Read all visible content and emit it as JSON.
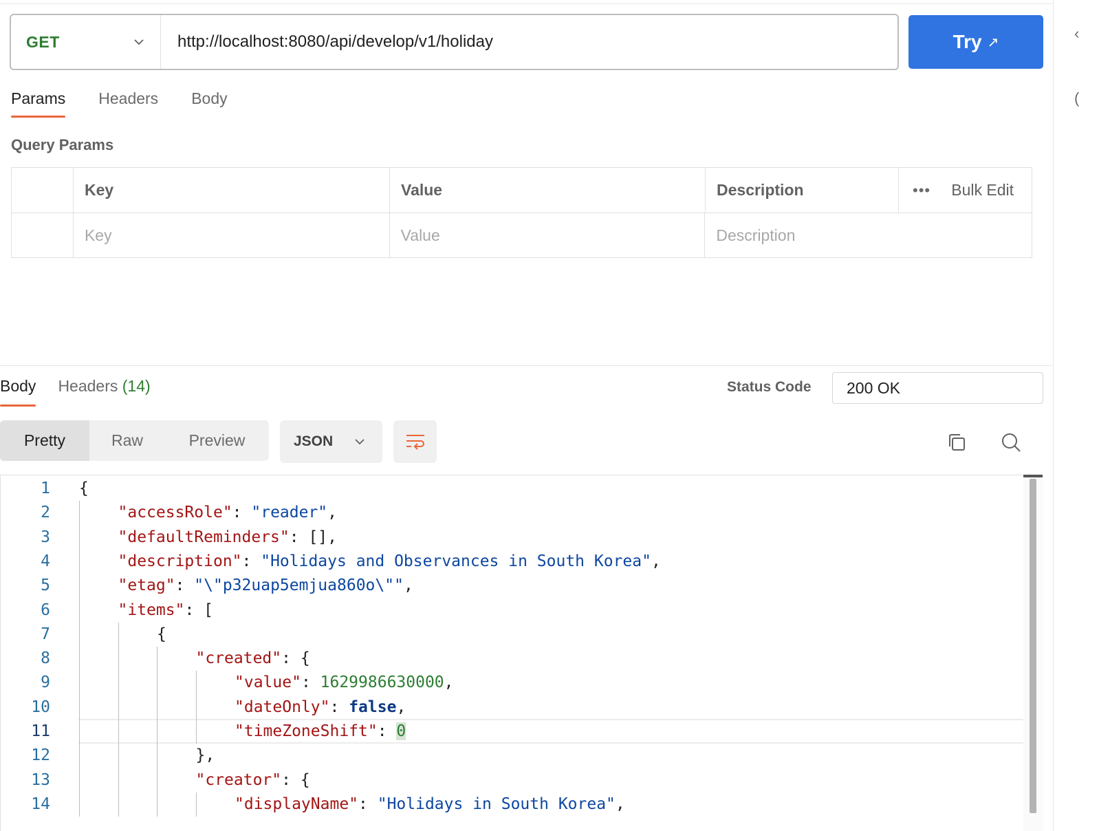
{
  "request": {
    "method": "GET",
    "url": "http://localhost:8080/api/develop/v1/holiday",
    "try_label": "Try",
    "try_icon": "arrow-up-right-icon"
  },
  "request_tabs": [
    "Params",
    "Headers",
    "Body"
  ],
  "query_params": {
    "title": "Query Params",
    "columns": [
      "Key",
      "Value",
      "Description"
    ],
    "bulk_edit_label": "Bulk Edit",
    "placeholders": {
      "key": "Key",
      "value": "Value",
      "description": "Description"
    }
  },
  "response": {
    "tabs": {
      "body": "Body",
      "headers": "Headers",
      "headers_count": "(14)"
    },
    "status_label": "Status Code",
    "status_value": "200 OK",
    "views": [
      "Pretty",
      "Raw",
      "Preview"
    ],
    "active_view": "Pretty",
    "format": "JSON"
  },
  "editor": {
    "current_line": 11,
    "lines": [
      {
        "num": "1",
        "indent": 0,
        "tokens": [
          [
            "p",
            "{"
          ]
        ]
      },
      {
        "num": "2",
        "indent": 1,
        "tokens": [
          [
            "k",
            "\"accessRole\""
          ],
          [
            "p",
            ": "
          ],
          [
            "s",
            "\"reader\""
          ],
          [
            "p",
            ","
          ]
        ]
      },
      {
        "num": "3",
        "indent": 1,
        "tokens": [
          [
            "k",
            "\"defaultReminders\""
          ],
          [
            "p",
            ": [],"
          ]
        ]
      },
      {
        "num": "4",
        "indent": 1,
        "tokens": [
          [
            "k",
            "\"description\""
          ],
          [
            "p",
            ": "
          ],
          [
            "s",
            "\"Holidays and Observances in South Korea\""
          ],
          [
            "p",
            ","
          ]
        ]
      },
      {
        "num": "5",
        "indent": 1,
        "tokens": [
          [
            "k",
            "\"etag\""
          ],
          [
            "p",
            ": "
          ],
          [
            "s",
            "\"\\\"p32uap5emjua860o\\\"\""
          ],
          [
            "p",
            ","
          ]
        ]
      },
      {
        "num": "6",
        "indent": 1,
        "tokens": [
          [
            "k",
            "\"items\""
          ],
          [
            "p",
            ": ["
          ]
        ]
      },
      {
        "num": "7",
        "indent": 2,
        "tokens": [
          [
            "p",
            "{"
          ]
        ]
      },
      {
        "num": "8",
        "indent": 3,
        "tokens": [
          [
            "k",
            "\"created\""
          ],
          [
            "p",
            ": {"
          ]
        ]
      },
      {
        "num": "9",
        "indent": 4,
        "tokens": [
          [
            "k",
            "\"value\""
          ],
          [
            "p",
            ": "
          ],
          [
            "n",
            "1629986630000"
          ],
          [
            "p",
            ","
          ]
        ]
      },
      {
        "num": "10",
        "indent": 4,
        "tokens": [
          [
            "k",
            "\"dateOnly\""
          ],
          [
            "p",
            ": "
          ],
          [
            "b",
            "false"
          ],
          [
            "p",
            ","
          ]
        ]
      },
      {
        "num": "11",
        "indent": 4,
        "tokens": [
          [
            "k",
            "\"timeZoneShift\""
          ],
          [
            "p",
            ": "
          ],
          [
            "n caret",
            "0"
          ]
        ]
      },
      {
        "num": "12",
        "indent": 3,
        "tokens": [
          [
            "p",
            "},"
          ]
        ]
      },
      {
        "num": "13",
        "indent": 3,
        "tokens": [
          [
            "k",
            "\"creator\""
          ],
          [
            "p",
            ": {"
          ]
        ]
      },
      {
        "num": "14",
        "indent": 4,
        "tokens": [
          [
            "k",
            "\"displayName\""
          ],
          [
            "p",
            ": "
          ],
          [
            "s",
            "\"Holidays in South Korea\""
          ],
          [
            "p",
            ","
          ]
        ]
      }
    ]
  },
  "icons": {
    "method_dropdown": "chevron-down-icon",
    "format_dropdown": "chevron-down-icon",
    "wrap": "wrap-lines-icon",
    "copy": "copy-icon",
    "search": "search-icon",
    "more": "more-horizontal-icon"
  },
  "colors": {
    "accent_blue": "#2f74e0",
    "tab_underline": "#e8663a",
    "method_green": "#2f7d32"
  }
}
